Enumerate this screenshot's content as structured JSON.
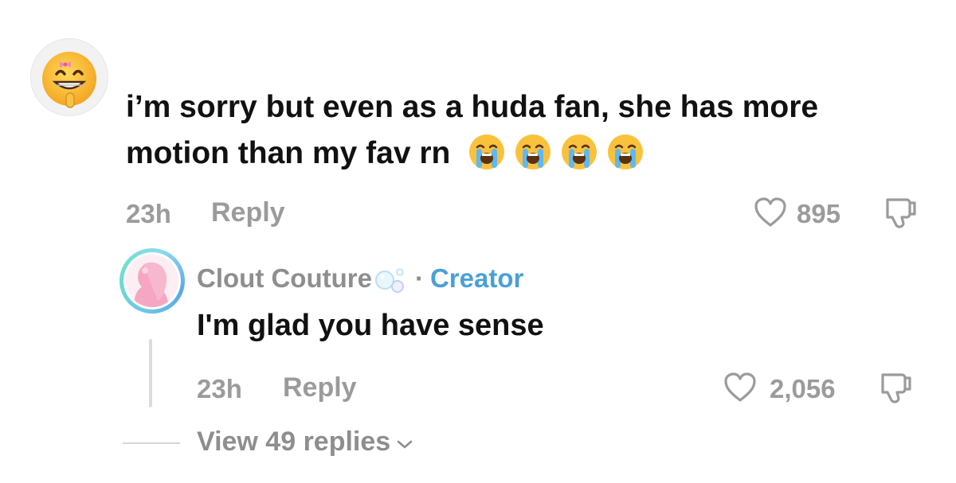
{
  "comment": {
    "text": "i’m sorry but even as a huda fan, she has more motion than my fav rn",
    "time": "23h",
    "reply_label": "Reply",
    "like_count": "895",
    "avatar_icon": "grinning-emoji-with-bow-icon",
    "emojis": [
      "loudly-crying-face-icon",
      "loudly-crying-face-icon",
      "loudly-crying-face-icon",
      "loudly-crying-face-icon"
    ]
  },
  "reply": {
    "username": "Clout Couture",
    "separator": "·",
    "badge": "Creator",
    "text": "I'm glad you have sense",
    "time": "23h",
    "reply_label": "Reply",
    "like_count": "2,056",
    "name_icon": "bubbles-icon"
  },
  "view_replies": {
    "label": "View 49 replies"
  },
  "colors": {
    "muted": "#9b9b9b",
    "creator": "#4aa0d6",
    "text": "#111111",
    "avatar_ring": "#6fe0c9"
  }
}
